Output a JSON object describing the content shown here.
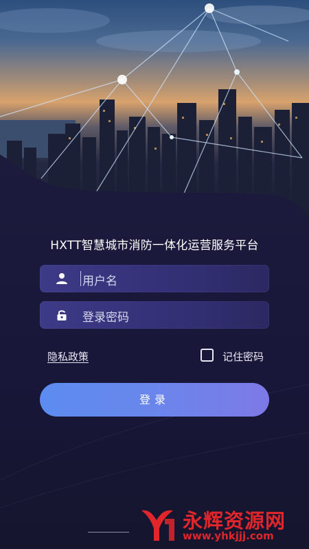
{
  "app": {
    "title": "HXTT智慧城市消防一体化运营服务平台"
  },
  "form": {
    "username_placeholder": "用户名",
    "password_placeholder": "登录密码",
    "privacy_label": "隐私政策",
    "remember_label": "记住密码",
    "remember_checked": false,
    "login_label": "登录"
  },
  "icons": {
    "user": "user-icon",
    "lock": "lock-icon"
  },
  "watermark": {
    "name": "永辉资源网",
    "url": "www.yhkjjj.com"
  },
  "colors": {
    "background": "#16162f",
    "field": "#3d3a87",
    "button_start": "#5c8cf0",
    "button_end": "#7d79e6",
    "watermark": "#e0262a"
  }
}
